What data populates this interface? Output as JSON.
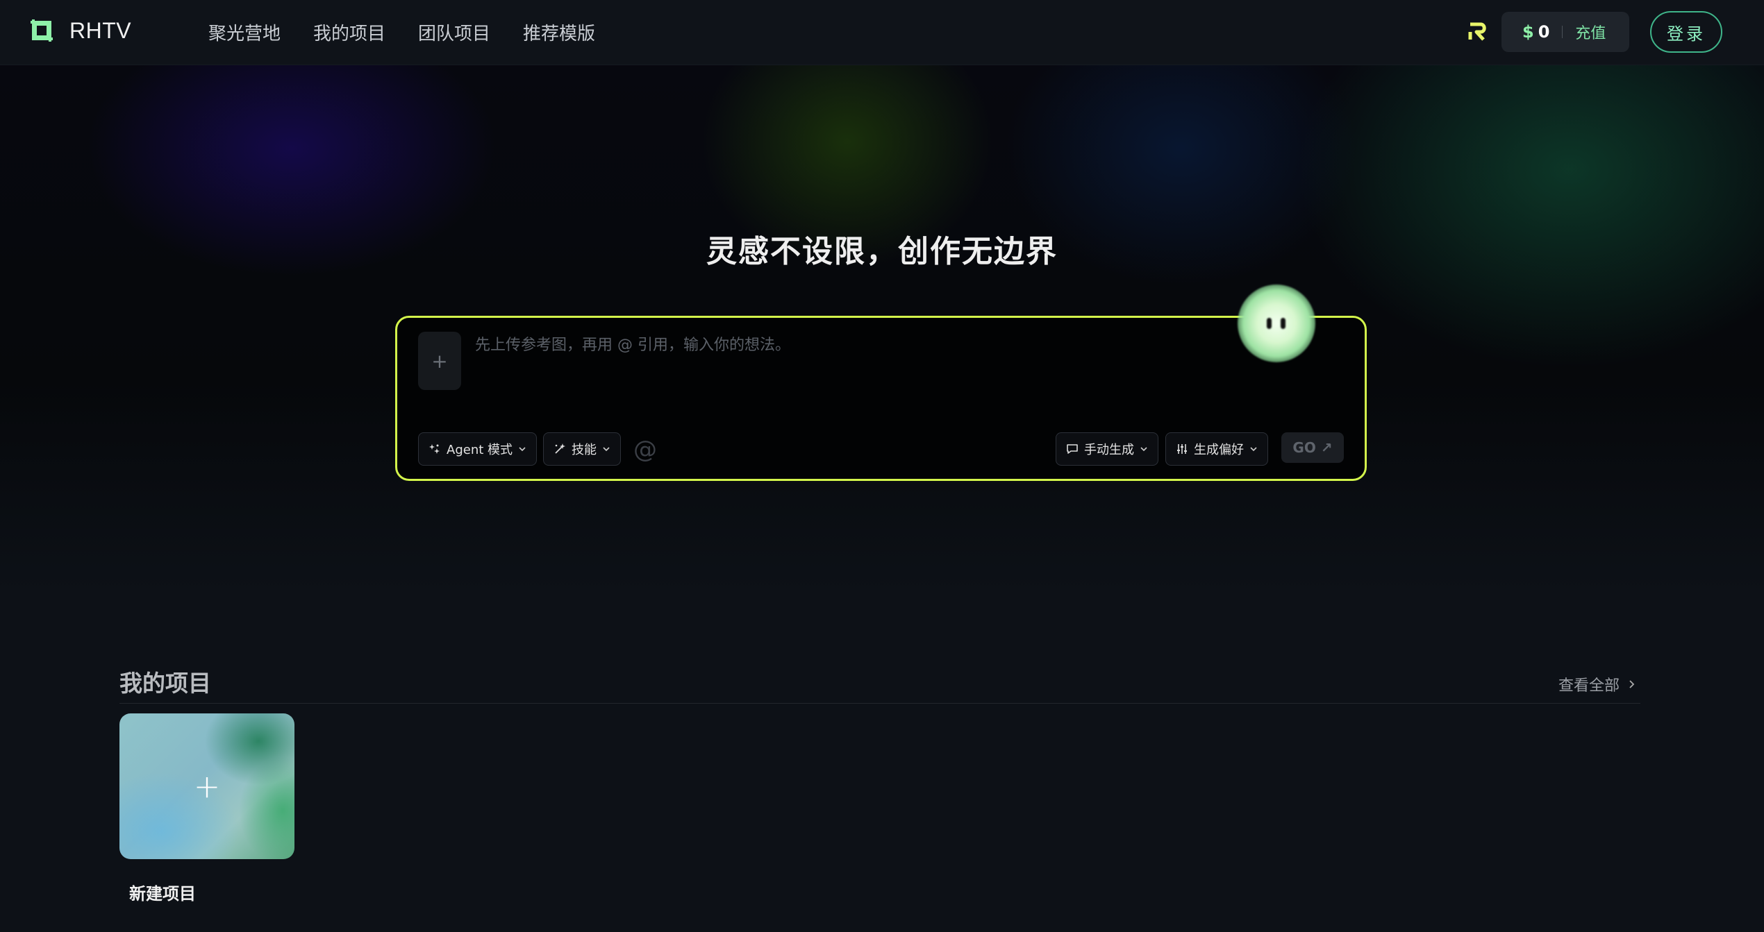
{
  "header": {
    "brand": "RHTV",
    "nav": [
      "聚光营地",
      "我的项目",
      "团队项目",
      "推荐模版"
    ],
    "balance_currency": "$",
    "balance_amount": "0",
    "recharge_label": "充值",
    "login_label": "登录"
  },
  "hero": {
    "title": "灵感不设限，创作无边界",
    "prompt_placeholder": "先上传参考图，再用 @ 引用，输入你的想法。",
    "upload_symbol": "+",
    "agent_mode_label": "Agent  模式",
    "skills_label": "技能",
    "at_symbol": "@",
    "manual_generate_label": "手动生成",
    "preferences_label": "生成偏好",
    "go_label": "GO ↗"
  },
  "projects": {
    "section_title": "我的项目",
    "view_all_label": "查看全部",
    "new_project_label": "新建项目",
    "new_project_symbol": "+"
  },
  "colors": {
    "accent_border": "#d3f54b",
    "brand_green": "#8ef0a8",
    "login_border": "#3fb58a",
    "page_bg": "#0d1117"
  },
  "icons": {
    "logo": "crop-frame-icon",
    "brand_badge": "r-logo-icon",
    "agent": "sparkle-icon",
    "skills": "magic-wand-icon",
    "manual": "chat-bubble-icon",
    "preferences": "sliders-icon",
    "chevron": "chevron-down-icon",
    "view_all_chevron": "chevron-right-icon"
  }
}
